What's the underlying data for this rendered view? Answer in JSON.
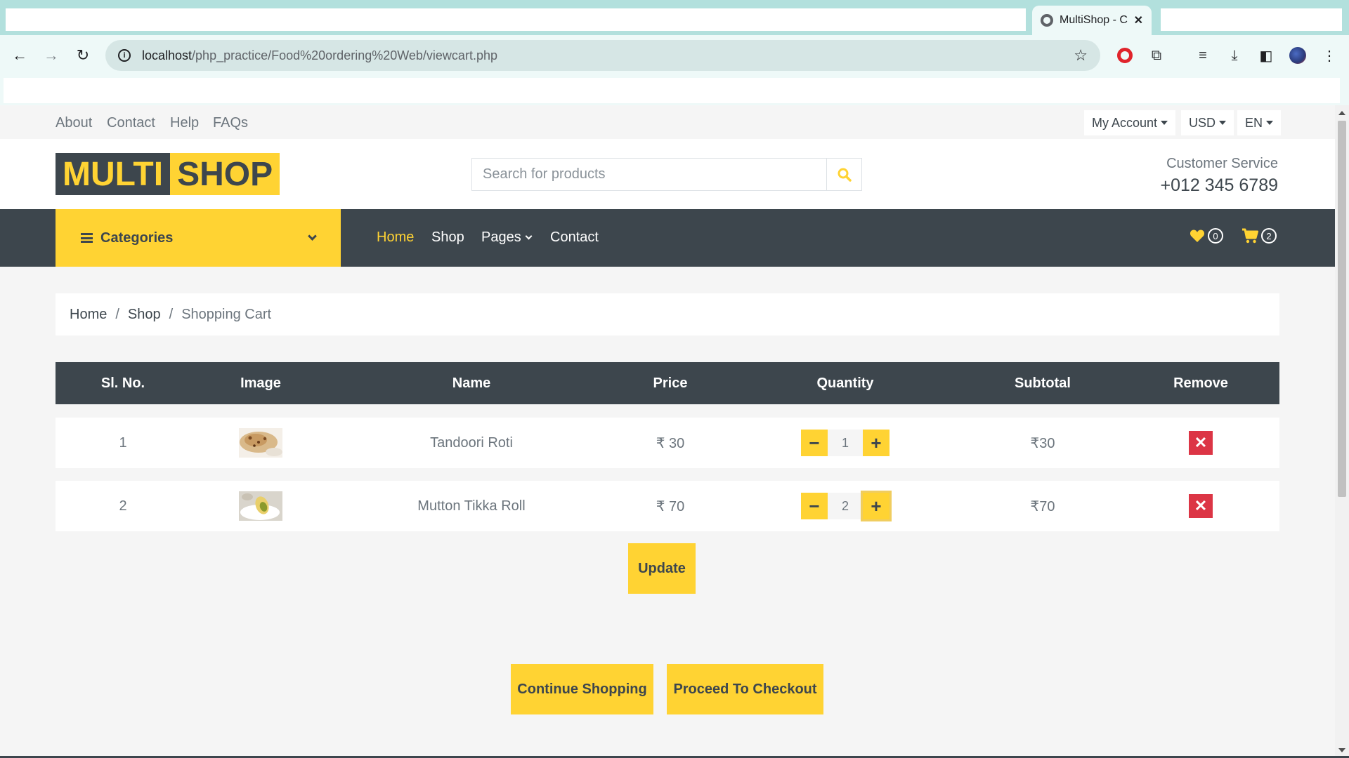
{
  "browser": {
    "tab_title": "MultiShop - C",
    "url_host": "localhost",
    "url_path": "/php_practice/Food%20ordering%20Web/viewcart.php"
  },
  "topbar": {
    "links": [
      "About",
      "Contact",
      "Help",
      "FAQs"
    ],
    "account_label": "My Account",
    "currency_label": "USD",
    "language_label": "EN"
  },
  "header": {
    "logo_part1": "MULTI",
    "logo_part2": "SHOP",
    "search_placeholder": "Search for products",
    "customer_service_label": "Customer Service",
    "phone": "+012 345 6789"
  },
  "navbar": {
    "categories_label": "Categories",
    "links": [
      "Home",
      "Shop",
      "Pages",
      "Contact"
    ],
    "active_link": "Home",
    "wishlist_count": "0",
    "cart_count": "2"
  },
  "breadcrumb": [
    "Home",
    "Shop",
    "Shopping Cart"
  ],
  "cart_table": {
    "headers": [
      "Sl. No.",
      "Image",
      "Name",
      "Price",
      "Quantity",
      "Subtotal",
      "Remove"
    ],
    "rows": [
      {
        "sl": "1",
        "name": "Tandoori Roti",
        "price": "₹ 30",
        "qty": "1",
        "subtotal": "₹30"
      },
      {
        "sl": "2",
        "name": "Mutton Tikka Roll",
        "price": "₹ 70",
        "qty": "2",
        "subtotal": "₹70"
      }
    ]
  },
  "buttons": {
    "update": "Update",
    "continue_shopping": "Continue Shopping",
    "checkout": "Proceed To Checkout"
  },
  "colors": {
    "accent": "#ffd333",
    "dark": "#3d464d",
    "danger": "#dc3545",
    "chrome": "#b2e0dd"
  }
}
